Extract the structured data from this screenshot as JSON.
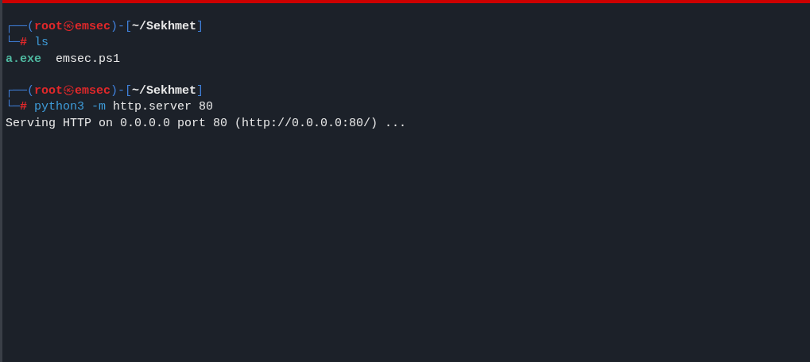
{
  "lines": [
    {
      "kind": "prompt",
      "open": "┌──(",
      "user": "root",
      "at": "㉿",
      "host": "emsec",
      "mid": ")-[",
      "path": "~/Sekhmet",
      "close": "]",
      "corner": "└─",
      "symbol": "#",
      "command": [
        {
          "kind": "program",
          "text": "ls"
        }
      ]
    },
    {
      "kind": "output",
      "items": [
        {
          "kind": "executable",
          "text": "a.exe"
        },
        {
          "kind": "file",
          "text": "emsec.ps1"
        }
      ]
    },
    {
      "kind": "blank"
    },
    {
      "kind": "prompt",
      "open": "┌──(",
      "user": "root",
      "at": "㉿",
      "host": "emsec",
      "mid": ")-[",
      "path": "~/Sekhmet",
      "close": "]",
      "corner": "└─",
      "symbol": "#",
      "command": [
        {
          "kind": "program",
          "text": "python3"
        },
        {
          "kind": "option",
          "text": "-m"
        },
        {
          "kind": "argument",
          "text": "http.server"
        },
        {
          "kind": "argument",
          "text": "80"
        }
      ]
    },
    {
      "kind": "output",
      "items": [
        {
          "kind": "text",
          "text": "Serving HTTP on 0.0.0.0 port 80 (http://0.0.0.0:80/) ..."
        }
      ]
    }
  ]
}
